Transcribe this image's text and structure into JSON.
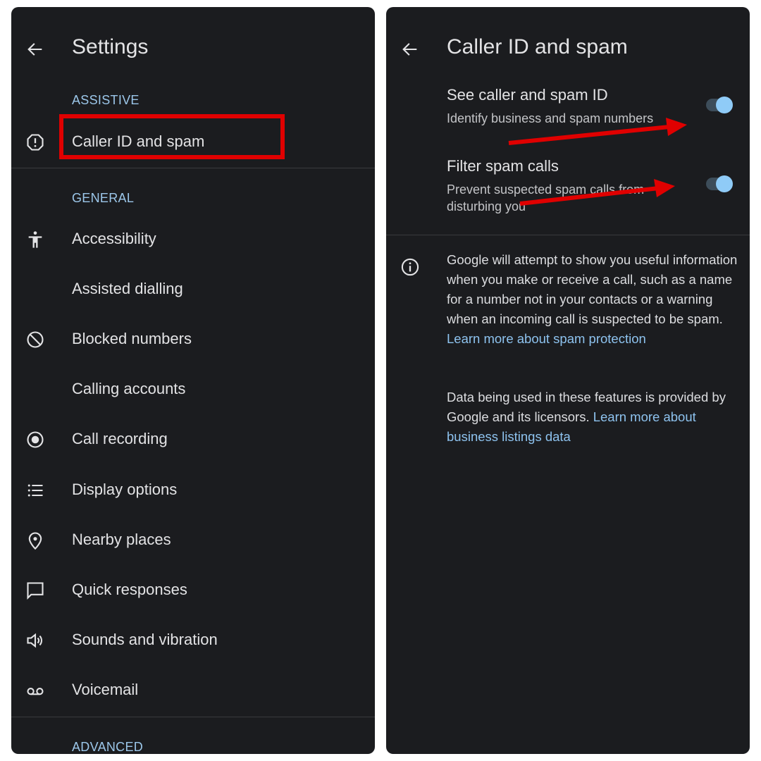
{
  "left_screen": {
    "title": "Settings",
    "sections": [
      {
        "header": "ASSISTIVE",
        "items": [
          {
            "label": "Caller ID and spam",
            "icon": "alert-octagon-icon",
            "highlighted": true
          }
        ]
      },
      {
        "header": "GENERAL",
        "items": [
          {
            "label": "Accessibility",
            "icon": "accessibility-icon"
          },
          {
            "label": "Assisted dialling",
            "icon": ""
          },
          {
            "label": "Blocked numbers",
            "icon": "block-icon"
          },
          {
            "label": "Calling accounts",
            "icon": ""
          },
          {
            "label": "Call recording",
            "icon": "record-icon"
          },
          {
            "label": "Display options",
            "icon": "list-icon"
          },
          {
            "label": "Nearby places",
            "icon": "location-pin-icon"
          },
          {
            "label": "Quick responses",
            "icon": "chat-bubble-icon"
          },
          {
            "label": "Sounds and vibration",
            "icon": "volume-icon"
          },
          {
            "label": "Voicemail",
            "icon": "voicemail-icon"
          }
        ]
      },
      {
        "header": "ADVANCED",
        "items": []
      }
    ]
  },
  "right_screen": {
    "title": "Caller ID and spam",
    "settings": [
      {
        "title": "See caller and spam ID",
        "subtitle": "Identify business and spam numbers",
        "enabled": true
      },
      {
        "title": "Filter spam calls",
        "subtitle": "Prevent suspected spam calls from disturbing you",
        "enabled": true
      }
    ],
    "info": {
      "paragraph1": "Google will attempt to show you useful information when you make or receive a call, such as a name for a number not in your contacts or a warning when an incoming call is suspected to be spam. ",
      "link1": "Learn more about spam protection",
      "paragraph2": "Data being used in these features is provided by Google and its licensors. ",
      "link2": "Learn more about business listings data"
    }
  },
  "colors": {
    "background": "#1b1c1f",
    "text": "#e3e3e5",
    "accent": "#9cc7ea",
    "toggle_on": "#8fcbf7",
    "annotation": "#e00000"
  }
}
